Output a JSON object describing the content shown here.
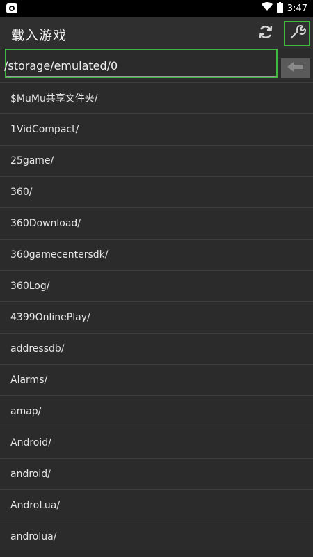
{
  "status_bar": {
    "time": "3:47",
    "left_icon": "screenshot-icon",
    "wifi_icon": "wifi-icon",
    "battery_icon": "battery-icon"
  },
  "app_bar": {
    "title": "载入游戏",
    "refresh_icon": "refresh-icon",
    "settings_icon": "wrench-icon"
  },
  "path_bar": {
    "path": "/storage/emulated/0",
    "back_icon": "back-arrow-icon"
  },
  "files": [
    "$MuMu共享文件夹/",
    "1VidCompact/",
    "25game/",
    "360/",
    "360Download/",
    "360gamecentersdk/",
    "360Log/",
    "4399OnlinePlay/",
    "addressdb/",
    "Alarms/",
    "amap/",
    "Android/",
    "android/",
    "AndroLua/",
    "androlua/"
  ],
  "colors": {
    "accent_border": "#3fb93f",
    "background": "#2b2b2b"
  }
}
